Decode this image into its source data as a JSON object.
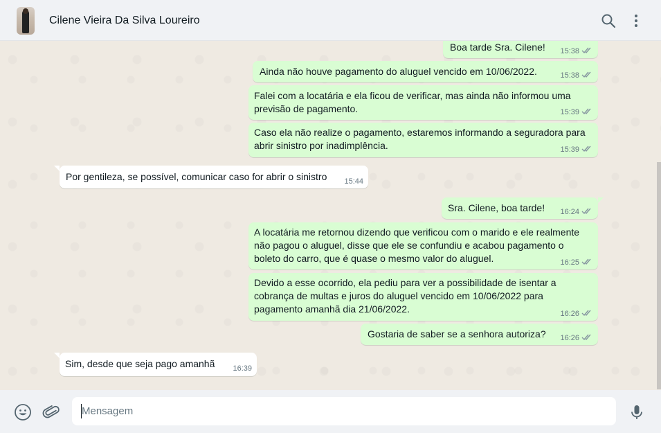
{
  "header": {
    "contact_name": "Cilene Vieira Da Silva Loureiro",
    "icons": [
      "search-icon",
      "menu-icon"
    ]
  },
  "colors": {
    "outgoing_bubble": "#d9fdd3",
    "incoming_bubble": "#ffffff",
    "chat_background": "#efeae2",
    "header_background": "#f0f2f5",
    "tick_color": "#8696a0"
  },
  "messages": [
    {
      "direction": "out",
      "text": "Boa tarde Sra. Cilene!",
      "time": "15:38",
      "status": "read"
    },
    {
      "direction": "out",
      "text": "Ainda não houve pagamento do aluguel vencido em 10/06/2022.",
      "time": "15:38",
      "status": "read"
    },
    {
      "direction": "out",
      "text_lines": [
        "Falei com a locatária e ela ficou de verificar, mas ainda não informou uma",
        "previsão de pagamento."
      ],
      "time": "15:39",
      "status": "read"
    },
    {
      "direction": "out",
      "text_lines": [
        "Caso ela não realize o pagamento, estaremos informando a seguradora para",
        "abrir sinistro por inadimplência."
      ],
      "time": "15:39",
      "status": "read"
    },
    {
      "direction": "in",
      "text": "Por gentileza, se possível, comunicar caso for abrir o sinistro",
      "time": "15:44"
    },
    {
      "direction": "out",
      "text": "Sra. Cilene, boa tarde!",
      "time": "16:24",
      "status": "read"
    },
    {
      "direction": "out",
      "text_lines": [
        "A locatária me retornou dizendo que verificou com o marido e ele realmente",
        "não pagou o aluguel, disse que ele se confundiu e acabou pagamento o",
        "boleto do carro, que é quase o mesmo valor do aluguel."
      ],
      "time": "16:25",
      "status": "read"
    },
    {
      "direction": "out",
      "text_lines": [
        "Devido a esse ocorrido, ela pediu para ver a possibilidade de isentar a",
        "cobrança de multas e juros do aluguel vencido em 10/06/2022 para",
        "pagamento amanhã dia 21/06/2022."
      ],
      "time": "16:26",
      "status": "read"
    },
    {
      "direction": "out",
      "text": "Gostaria de saber se a senhora autoriza?",
      "time": "16:26",
      "status": "read"
    },
    {
      "direction": "in",
      "text": "Sim, desde que seja pago amanhã",
      "time": "16:39"
    }
  ],
  "composer": {
    "placeholder": "Mensagem",
    "icons": [
      "emoji-icon",
      "attach-icon",
      "mic-icon"
    ]
  }
}
